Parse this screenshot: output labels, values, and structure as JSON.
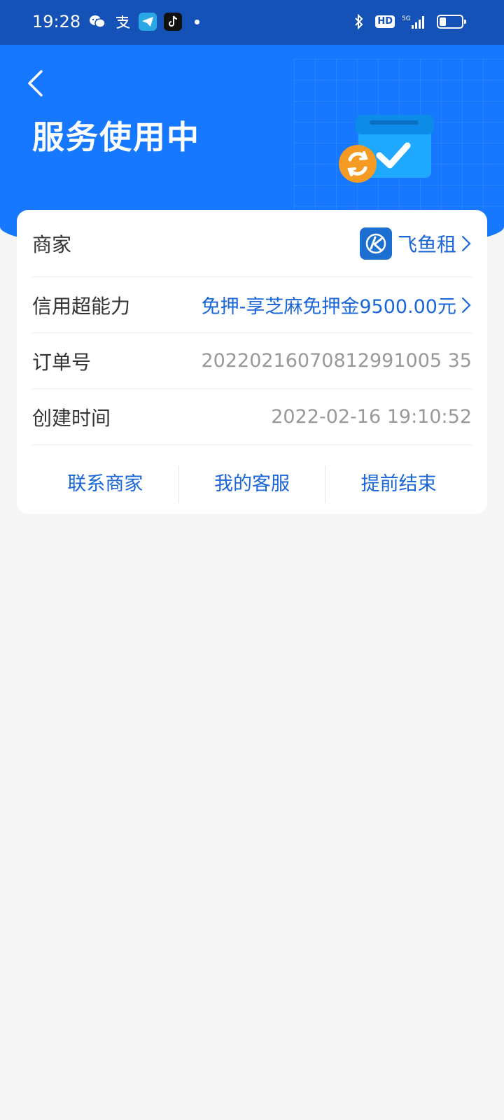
{
  "status_bar": {
    "time": "19:28",
    "left_icons": [
      "wechat-icon",
      "alipay-icon",
      "telegram-icon",
      "tiktok-icon",
      "notification-dot"
    ],
    "right_icons": [
      "bluetooth-icon",
      "hd-icon",
      "signal-5g-icon",
      "battery-icon"
    ],
    "hd_label": "HD",
    "network_label": "5G"
  },
  "header": {
    "title": "服务使用中",
    "background_color": "#1677ff"
  },
  "card": {
    "rows": [
      {
        "label": "商家",
        "value": "飞鱼租"
      },
      {
        "label": "信用超能力",
        "value": "免押-享芝麻免押金9500.00元"
      },
      {
        "label": "订单号",
        "value": "20220216070812991005 35"
      },
      {
        "label": "创建时间",
        "value": "2022-02-16 19:10:52"
      }
    ],
    "actions": [
      "联系商家",
      "我的客服",
      "提前结束"
    ]
  },
  "colors": {
    "accent": "#1677ff",
    "link": "#1a66d9",
    "status_bar": "#1452b8"
  }
}
